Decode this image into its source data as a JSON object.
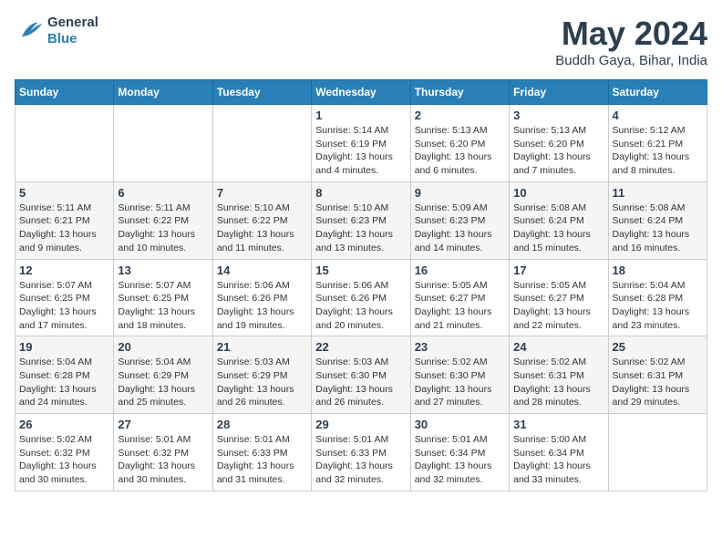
{
  "header": {
    "logo_line1": "General",
    "logo_line2": "Blue",
    "title": "May 2024",
    "subtitle": "Buddh Gaya, Bihar, India"
  },
  "weekdays": [
    "Sunday",
    "Monday",
    "Tuesday",
    "Wednesday",
    "Thursday",
    "Friday",
    "Saturday"
  ],
  "weeks": [
    [
      {
        "day": "",
        "info": ""
      },
      {
        "day": "",
        "info": ""
      },
      {
        "day": "",
        "info": ""
      },
      {
        "day": "1",
        "info": "Sunrise: 5:14 AM\nSunset: 6:19 PM\nDaylight: 13 hours\nand 4 minutes."
      },
      {
        "day": "2",
        "info": "Sunrise: 5:13 AM\nSunset: 6:20 PM\nDaylight: 13 hours\nand 6 minutes."
      },
      {
        "day": "3",
        "info": "Sunrise: 5:13 AM\nSunset: 6:20 PM\nDaylight: 13 hours\nand 7 minutes."
      },
      {
        "day": "4",
        "info": "Sunrise: 5:12 AM\nSunset: 6:21 PM\nDaylight: 13 hours\nand 8 minutes."
      }
    ],
    [
      {
        "day": "5",
        "info": "Sunrise: 5:11 AM\nSunset: 6:21 PM\nDaylight: 13 hours\nand 9 minutes."
      },
      {
        "day": "6",
        "info": "Sunrise: 5:11 AM\nSunset: 6:22 PM\nDaylight: 13 hours\nand 10 minutes."
      },
      {
        "day": "7",
        "info": "Sunrise: 5:10 AM\nSunset: 6:22 PM\nDaylight: 13 hours\nand 11 minutes."
      },
      {
        "day": "8",
        "info": "Sunrise: 5:10 AM\nSunset: 6:23 PM\nDaylight: 13 hours\nand 13 minutes."
      },
      {
        "day": "9",
        "info": "Sunrise: 5:09 AM\nSunset: 6:23 PM\nDaylight: 13 hours\nand 14 minutes."
      },
      {
        "day": "10",
        "info": "Sunrise: 5:08 AM\nSunset: 6:24 PM\nDaylight: 13 hours\nand 15 minutes."
      },
      {
        "day": "11",
        "info": "Sunrise: 5:08 AM\nSunset: 6:24 PM\nDaylight: 13 hours\nand 16 minutes."
      }
    ],
    [
      {
        "day": "12",
        "info": "Sunrise: 5:07 AM\nSunset: 6:25 PM\nDaylight: 13 hours\nand 17 minutes."
      },
      {
        "day": "13",
        "info": "Sunrise: 5:07 AM\nSunset: 6:25 PM\nDaylight: 13 hours\nand 18 minutes."
      },
      {
        "day": "14",
        "info": "Sunrise: 5:06 AM\nSunset: 6:26 PM\nDaylight: 13 hours\nand 19 minutes."
      },
      {
        "day": "15",
        "info": "Sunrise: 5:06 AM\nSunset: 6:26 PM\nDaylight: 13 hours\nand 20 minutes."
      },
      {
        "day": "16",
        "info": "Sunrise: 5:05 AM\nSunset: 6:27 PM\nDaylight: 13 hours\nand 21 minutes."
      },
      {
        "day": "17",
        "info": "Sunrise: 5:05 AM\nSunset: 6:27 PM\nDaylight: 13 hours\nand 22 minutes."
      },
      {
        "day": "18",
        "info": "Sunrise: 5:04 AM\nSunset: 6:28 PM\nDaylight: 13 hours\nand 23 minutes."
      }
    ],
    [
      {
        "day": "19",
        "info": "Sunrise: 5:04 AM\nSunset: 6:28 PM\nDaylight: 13 hours\nand 24 minutes."
      },
      {
        "day": "20",
        "info": "Sunrise: 5:04 AM\nSunset: 6:29 PM\nDaylight: 13 hours\nand 25 minutes."
      },
      {
        "day": "21",
        "info": "Sunrise: 5:03 AM\nSunset: 6:29 PM\nDaylight: 13 hours\nand 26 minutes."
      },
      {
        "day": "22",
        "info": "Sunrise: 5:03 AM\nSunset: 6:30 PM\nDaylight: 13 hours\nand 26 minutes."
      },
      {
        "day": "23",
        "info": "Sunrise: 5:02 AM\nSunset: 6:30 PM\nDaylight: 13 hours\nand 27 minutes."
      },
      {
        "day": "24",
        "info": "Sunrise: 5:02 AM\nSunset: 6:31 PM\nDaylight: 13 hours\nand 28 minutes."
      },
      {
        "day": "25",
        "info": "Sunrise: 5:02 AM\nSunset: 6:31 PM\nDaylight: 13 hours\nand 29 minutes."
      }
    ],
    [
      {
        "day": "26",
        "info": "Sunrise: 5:02 AM\nSunset: 6:32 PM\nDaylight: 13 hours\nand 30 minutes."
      },
      {
        "day": "27",
        "info": "Sunrise: 5:01 AM\nSunset: 6:32 PM\nDaylight: 13 hours\nand 30 minutes."
      },
      {
        "day": "28",
        "info": "Sunrise: 5:01 AM\nSunset: 6:33 PM\nDaylight: 13 hours\nand 31 minutes."
      },
      {
        "day": "29",
        "info": "Sunrise: 5:01 AM\nSunset: 6:33 PM\nDaylight: 13 hours\nand 32 minutes."
      },
      {
        "day": "30",
        "info": "Sunrise: 5:01 AM\nSunset: 6:34 PM\nDaylight: 13 hours\nand 32 minutes."
      },
      {
        "day": "31",
        "info": "Sunrise: 5:00 AM\nSunset: 6:34 PM\nDaylight: 13 hours\nand 33 minutes."
      },
      {
        "day": "",
        "info": ""
      }
    ]
  ]
}
